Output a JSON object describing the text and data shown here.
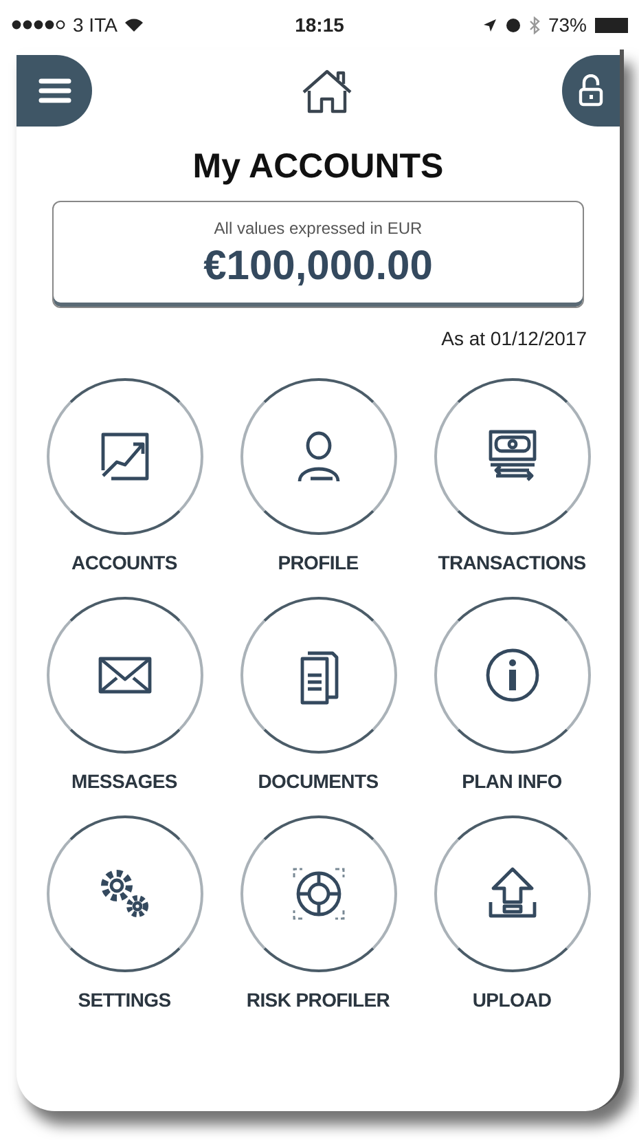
{
  "status_bar": {
    "carrier": "3 ITA",
    "time": "18:15",
    "battery": "73%"
  },
  "header": {
    "title": "My ACCOUNTS"
  },
  "balance": {
    "caption": "All values expressed in EUR",
    "amount": "€100,000.00",
    "as_at": "As at 01/12/2017"
  },
  "tiles": [
    {
      "label": "ACCOUNTS",
      "kind": "chart"
    },
    {
      "label": "PROFILE",
      "kind": "person"
    },
    {
      "label": "TRANSACTIONS",
      "kind": "money"
    },
    {
      "label": "MESSAGES",
      "kind": "mail"
    },
    {
      "label": "DOCUMENTS",
      "kind": "document"
    },
    {
      "label": "PLAN INFO",
      "kind": "info"
    },
    {
      "label": "SETTINGS",
      "kind": "gears"
    },
    {
      "label": "RISK PROFILER",
      "kind": "lifebuoy"
    },
    {
      "label": "UPLOAD",
      "kind": "upload"
    }
  ]
}
